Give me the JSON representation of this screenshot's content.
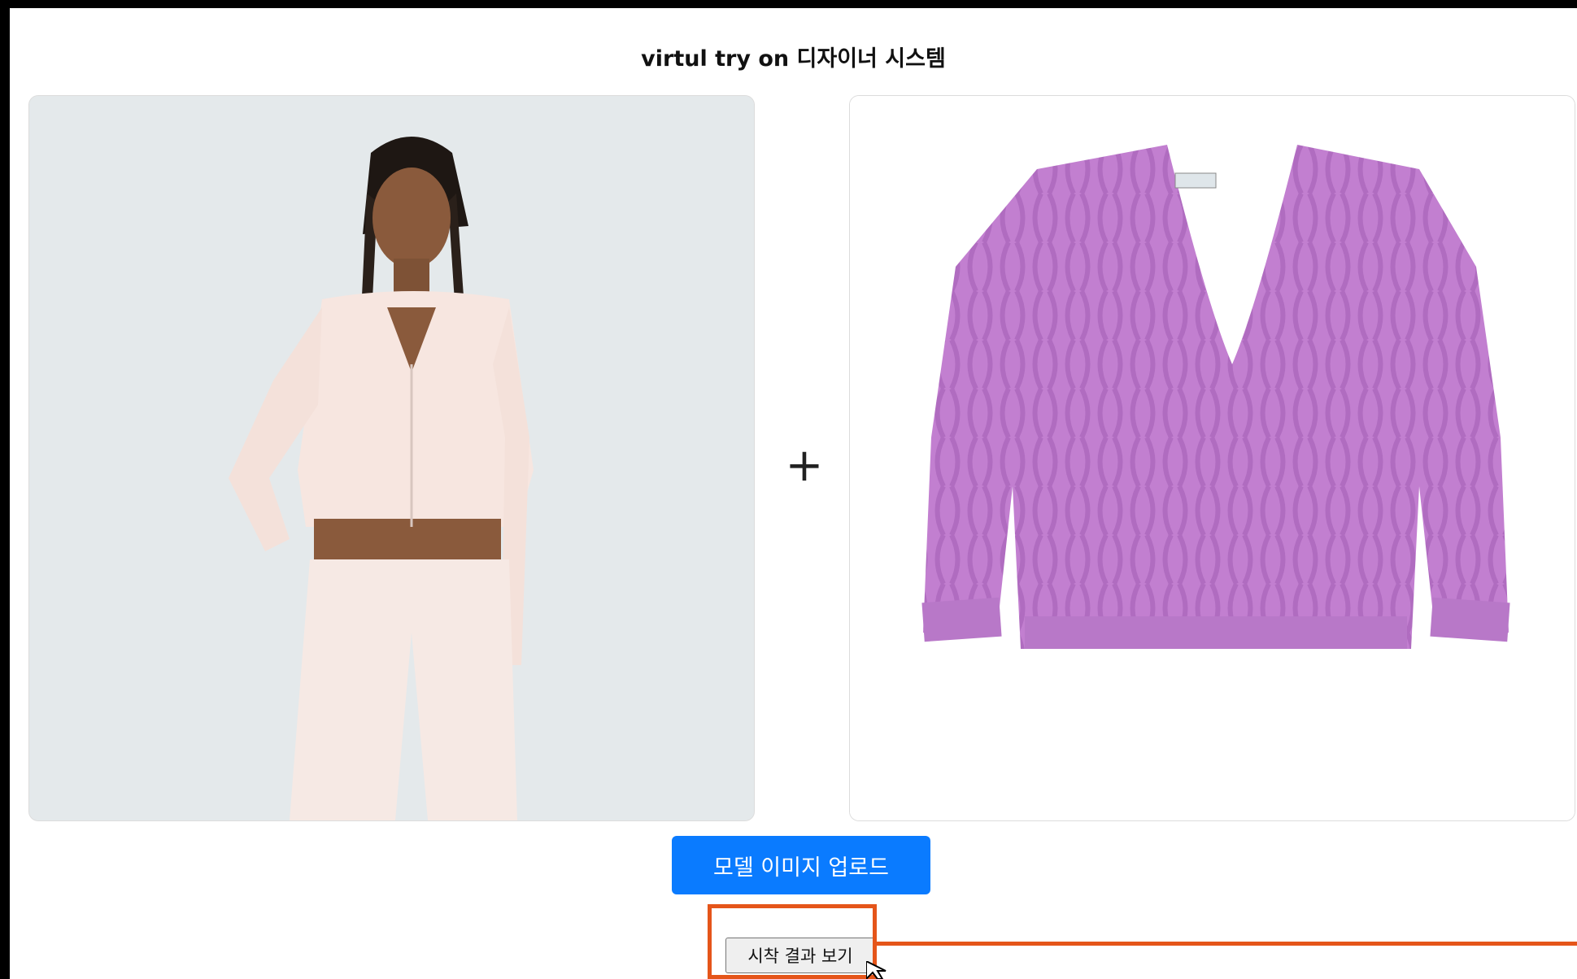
{
  "page": {
    "title": "virtul try on 디자이너 시스템",
    "plus_symbol": "+"
  },
  "buttons": {
    "upload_model_label": "모델 이미지 업로드",
    "view_result_label": "시착 결과 보기"
  },
  "colors": {
    "primary_button": "#0a7bff",
    "highlight": "#e5551a",
    "model_panel_bg": "#e4e9eb",
    "sweater": "#c27fd0"
  },
  "images": {
    "model_image": "model-photo",
    "garment_image": "purple-cable-knit-sweater"
  }
}
